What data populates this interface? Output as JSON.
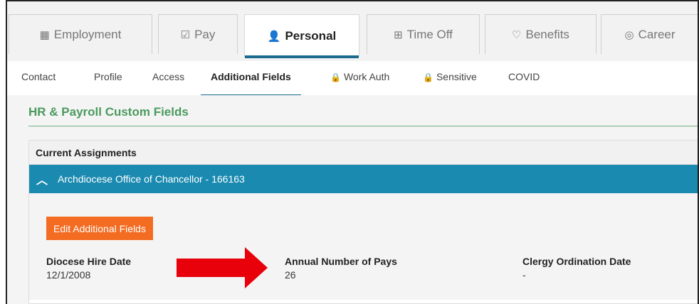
{
  "tabs": [
    {
      "label": "Employment",
      "icon": "building-icon",
      "glyph": "▦"
    },
    {
      "label": "Pay",
      "icon": "check-document-icon",
      "glyph": "☑"
    },
    {
      "label": "Personal",
      "icon": "person-icon",
      "glyph": "👤"
    },
    {
      "label": "Time Off",
      "icon": "calendar-grid-icon",
      "glyph": "⊞"
    },
    {
      "label": "Benefits",
      "icon": "heart-icon",
      "glyph": "♡"
    },
    {
      "label": "Career",
      "icon": "target-icon",
      "glyph": "◎"
    }
  ],
  "subnav": [
    {
      "label": "Contact"
    },
    {
      "label": "Profile"
    },
    {
      "label": "Access"
    },
    {
      "label": "Additional Fields"
    },
    {
      "label": "Work Auth",
      "locked": true
    },
    {
      "label": "Sensitive",
      "locked": true
    },
    {
      "label": "COVID"
    }
  ],
  "section": {
    "title": "HR & Payroll Custom Fields",
    "card_header": "Current Assignments",
    "assignment": "Archdiocese Office of Chancellor - 166163",
    "edit_button": "Edit Additional Fields",
    "fields": [
      {
        "label": "Diocese Hire Date",
        "value": "12/1/2008"
      },
      {
        "label": "Annual Number of Pays",
        "value": "26"
      },
      {
        "label": "Clergy Ordination Date",
        "value": "-"
      }
    ]
  },
  "colors": {
    "accent": "#1b6a8f",
    "assignment_bar": "#1a8ab0",
    "button": "#f36c22",
    "section_title": "#4b9a5e",
    "arrow": "#e8000b"
  }
}
